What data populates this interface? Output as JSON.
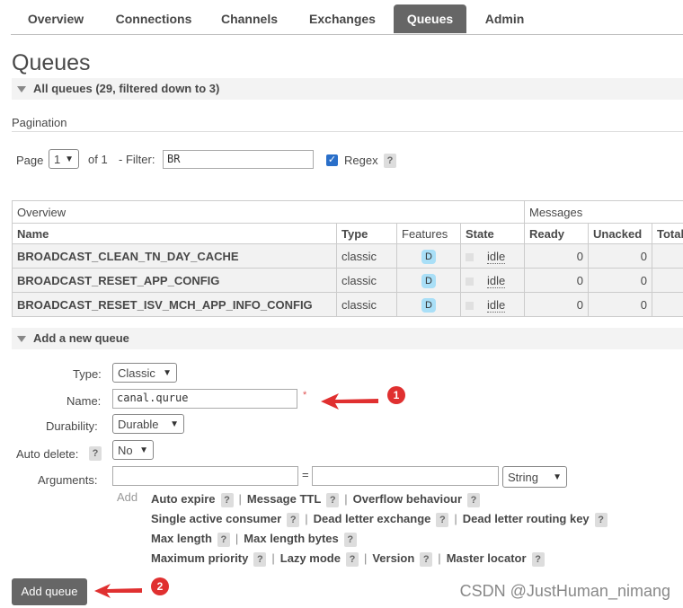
{
  "nav": {
    "tabs": [
      "Overview",
      "Connections",
      "Channels",
      "Exchanges",
      "Queues",
      "Admin"
    ],
    "active": "Queues"
  },
  "page_title": "Queues",
  "all_queues_label": "All queues (29, filtered down to 3)",
  "pagination": {
    "heading": "Pagination",
    "page_label": "Page",
    "page_value": "1",
    "of_label": "of 1",
    "filter_label": "- Filter:",
    "filter_value": "BR",
    "regex_label": "Regex",
    "help": "?"
  },
  "table": {
    "group_overview": "Overview",
    "group_messages": "Messages",
    "headers": [
      "Name",
      "Type",
      "Features",
      "State",
      "Ready",
      "Unacked",
      "Total"
    ],
    "rows": [
      {
        "name": "BROADCAST_CLEAN_TN_DAY_CACHE",
        "type": "classic",
        "feature": "D",
        "state": "idle",
        "ready": "0",
        "unacked": "0"
      },
      {
        "name": "BROADCAST_RESET_APP_CONFIG",
        "type": "classic",
        "feature": "D",
        "state": "idle",
        "ready": "0",
        "unacked": "0"
      },
      {
        "name": "BROADCAST_RESET_ISV_MCH_APP_INFO_CONFIG",
        "type": "classic",
        "feature": "D",
        "state": "idle",
        "ready": "0",
        "unacked": "0"
      }
    ]
  },
  "add_queue": {
    "section_label": "Add a new queue",
    "type_label": "Type:",
    "type_value": "Classic",
    "name_label": "Name:",
    "name_value": "canal.qurue",
    "required_mark": "*",
    "durability_label": "Durability:",
    "durability_value": "Durable",
    "auto_delete_label": "Auto delete:",
    "auto_delete_value": "No",
    "arguments_label": "Arguments:",
    "equals": "=",
    "arg_type_value": "String",
    "add_label": "Add",
    "arg_rows": [
      [
        "Auto expire",
        "Message TTL",
        "Overflow behaviour"
      ],
      [
        "Single active consumer",
        "Dead letter exchange",
        "Dead letter routing key"
      ],
      [
        "Max length",
        "Max length bytes"
      ],
      [
        "Maximum priority",
        "Lazy mode",
        "Version",
        "Master locator"
      ]
    ],
    "submit_label": "Add queue"
  },
  "annotations": {
    "marker1": "1",
    "marker2": "2",
    "arrow_color": "#e03030"
  },
  "watermark": "CSDN @JustHuman_nimang"
}
